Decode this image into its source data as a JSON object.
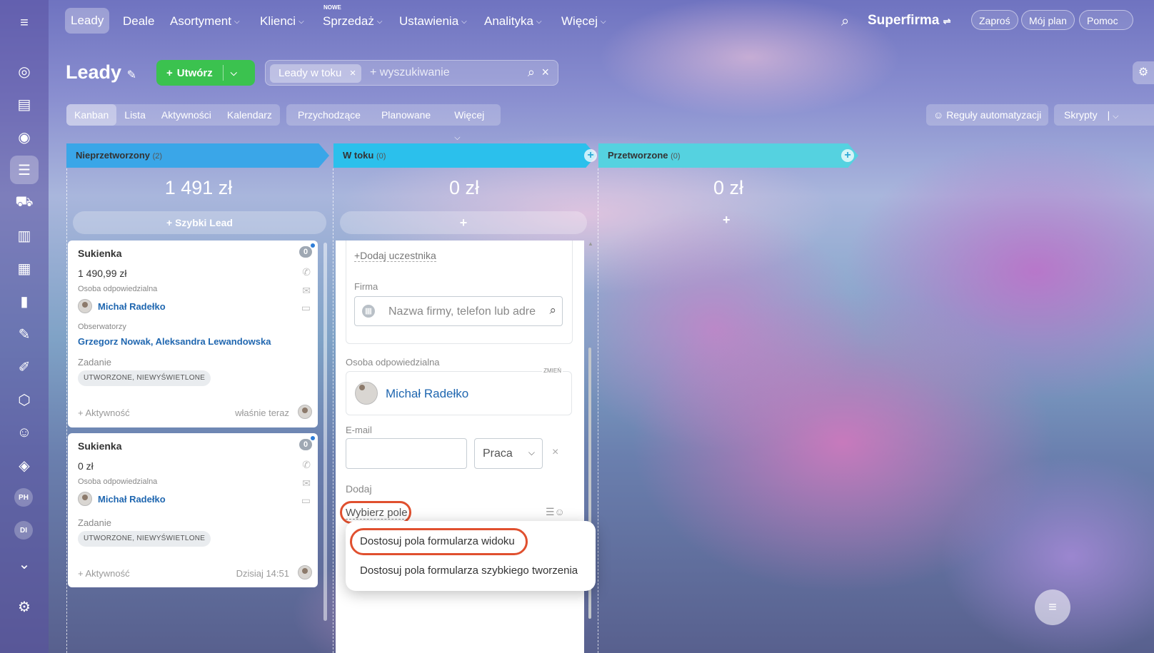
{
  "nav": {
    "items": [
      "Leady",
      "Deale",
      "Asortyment",
      "Klienci",
      "Sprzedaż",
      "Ustawienia",
      "Analityka",
      "Więcej"
    ],
    "badge_new": "NOWE",
    "company": "Superfirma",
    "invite": "Zaproś",
    "plan": "Mój plan",
    "help": "Pomoc"
  },
  "header": {
    "title": "Leady",
    "create": "Utwórz",
    "filter_chip": "Leady w toku",
    "search_placeholder": "+ wyszukiwanie"
  },
  "views": {
    "tabs": [
      "Kanban",
      "Lista",
      "Aktywności",
      "Kalendarz"
    ],
    "filters": [
      "Przychodzące",
      "Planowane",
      "Więcej"
    ],
    "automation": "Reguły automatyzacji",
    "scripts": "Skrypty"
  },
  "rail": {
    "av1": "PH",
    "av2": "DI"
  },
  "columns": [
    {
      "name": "Nieprzetworzony",
      "count": "(2)",
      "sum": "1 491 zł",
      "quick": "+ Szybki Lead",
      "color": "#3aa6e8"
    },
    {
      "name": "W toku",
      "count": "(0)",
      "sum": "0 zł",
      "color": "#2bc0ec"
    },
    {
      "name": "Przetworzone",
      "count": "(0)",
      "sum": "0 zł",
      "color": "#55d2e0"
    }
  ],
  "cards": [
    {
      "title": "Sukienka",
      "amount": "1 490,99 zł",
      "resp_label": "Osoba odpowiedzialna",
      "resp": "Michał Radełko",
      "obs_label": "Obserwatorzy",
      "obs": "Grzegorz Nowak, Aleksandra Lewandowska",
      "task_label": "Zadanie",
      "task": "UTWORZONE, NIEWYŚWIETLONE",
      "activity": "+ Aktywność",
      "time": "właśnie teraz",
      "badge": "0"
    },
    {
      "title": "Sukienka",
      "amount": "0 zł",
      "resp_label": "Osoba odpowiedzialna",
      "resp": "Michał Radełko",
      "task_label": "Zadanie",
      "task": "UTWORZONE, NIEWYŚWIETLONE",
      "activity": "+ Aktywność",
      "time": "Dzisiaj 14:51",
      "badge": "0"
    }
  ],
  "form": {
    "add_participant": "+Dodaj uczestnika",
    "company_label": "Firma",
    "company_placeholder": "Nazwa firmy, telefon lub adre",
    "resp_label": "Osoba odpowiedzialna",
    "change": "ZMIEŃ",
    "resp": "Michał Radełko",
    "email_label": "E-mail",
    "email_type": "Praca",
    "add_label": "Dodaj",
    "choose_field": "Wybierz pole"
  },
  "menu": {
    "item1": "Dostosuj pola formularza widoku",
    "item2": "Dostosuj pola formularza szybkiego tworzenia"
  }
}
